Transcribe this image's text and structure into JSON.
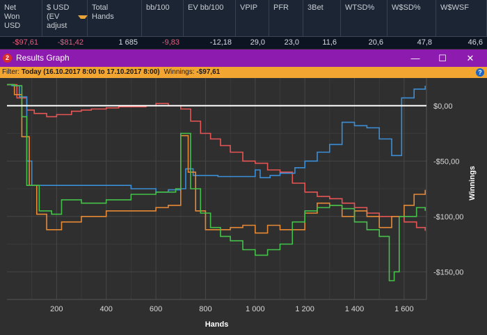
{
  "stats": {
    "columns": [
      {
        "label": "Net Won USD",
        "value": "-$97,61",
        "negative": true
      },
      {
        "label": "$ USD (EV adjust",
        "value": "-$81,42",
        "negative": true,
        "sorted": true
      },
      {
        "label": "Total Hands",
        "value": "1 685",
        "negative": false
      },
      {
        "label": "bb/100",
        "value": "-9,83",
        "negative": true
      },
      {
        "label": "EV bb/100",
        "value": "-12,18",
        "negative": false
      },
      {
        "label": "VPIP",
        "value": "29,0",
        "negative": false
      },
      {
        "label": "PFR",
        "value": "23,0",
        "negative": false
      },
      {
        "label": "3Bet",
        "value": "11,6",
        "negative": false
      },
      {
        "label": "WTSD%",
        "value": "20,6",
        "negative": false
      },
      {
        "label": "W$SD%",
        "value": "47,8",
        "negative": false
      },
      {
        "label": "W$WSF",
        "value": "46,6",
        "negative": false
      }
    ]
  },
  "window": {
    "icon_text": "2",
    "title": "Results Graph",
    "minimize_glyph": "—",
    "maximize_glyph": "☐",
    "close_glyph": "✕"
  },
  "filter": {
    "prefix": "Filter: ",
    "range": "Today (16.10.2017 8:00 to 17.10.2017 8:00)",
    "winnings_label": "Winnings: ",
    "winnings_value": "-$97,61",
    "help_glyph": "?"
  },
  "chart_data": {
    "type": "line",
    "xlabel": "Hands",
    "ylabel": "Winnings",
    "xlim": [
      0,
      1690
    ],
    "ylim": [
      -175,
      25
    ],
    "x_ticks": [
      200,
      400,
      600,
      800,
      1000,
      1200,
      1400,
      1600
    ],
    "x_tick_labels": [
      "200",
      "400",
      "600",
      "800",
      "1 000",
      "1 200",
      "1 400",
      "1 600"
    ],
    "y_ticks": [
      0,
      -50,
      -100,
      -150
    ],
    "y_tick_labels": [
      "$0,00",
      "-$50,00",
      "-$100,00",
      "-$150,00"
    ],
    "grid": true,
    "zero_line_color": "#ffffff",
    "series": [
      {
        "color": "#e85555",
        "points": [
          [
            0,
            19
          ],
          [
            40,
            7
          ],
          [
            80,
            -4
          ],
          [
            110,
            -7
          ],
          [
            160,
            -10
          ],
          [
            200,
            -8
          ],
          [
            260,
            -5
          ],
          [
            300,
            -4
          ],
          [
            340,
            -3
          ],
          [
            400,
            -2
          ],
          [
            450,
            -1
          ],
          [
            500,
            -1
          ],
          [
            560,
            0
          ],
          [
            600,
            2
          ],
          [
            650,
            0
          ],
          [
            700,
            -3
          ],
          [
            740,
            -14
          ],
          [
            780,
            -25
          ],
          [
            820,
            -30
          ],
          [
            860,
            -36
          ],
          [
            900,
            -42
          ],
          [
            950,
            -50
          ],
          [
            1000,
            -52
          ],
          [
            1050,
            -58
          ],
          [
            1100,
            -60
          ],
          [
            1150,
            -70
          ],
          [
            1200,
            -78
          ],
          [
            1250,
            -82
          ],
          [
            1300,
            -84
          ],
          [
            1350,
            -88
          ],
          [
            1400,
            -92
          ],
          [
            1450,
            -97
          ],
          [
            1500,
            -100
          ],
          [
            1550,
            -100
          ],
          [
            1600,
            -105
          ],
          [
            1650,
            -110
          ],
          [
            1685,
            -113
          ]
        ]
      },
      {
        "color": "#3a8fd8",
        "points": [
          [
            0,
            19
          ],
          [
            20,
            18
          ],
          [
            50,
            8
          ],
          [
            80,
            -50
          ],
          [
            100,
            -72
          ],
          [
            200,
            -72
          ],
          [
            300,
            -72
          ],
          [
            400,
            -72
          ],
          [
            500,
            -75
          ],
          [
            600,
            -78
          ],
          [
            650,
            -76
          ],
          [
            700,
            -75
          ],
          [
            720,
            -57
          ],
          [
            750,
            -63
          ],
          [
            850,
            -64
          ],
          [
            950,
            -64
          ],
          [
            1000,
            -58
          ],
          [
            1020,
            -65
          ],
          [
            1060,
            -63
          ],
          [
            1100,
            -61
          ],
          [
            1160,
            -56
          ],
          [
            1200,
            -50
          ],
          [
            1250,
            -42
          ],
          [
            1300,
            -35
          ],
          [
            1350,
            -15
          ],
          [
            1400,
            -18
          ],
          [
            1450,
            -20
          ],
          [
            1500,
            -30
          ],
          [
            1550,
            -45
          ],
          [
            1580,
            -45
          ],
          [
            1590,
            7
          ],
          [
            1640,
            15
          ],
          [
            1685,
            18
          ]
        ]
      },
      {
        "color": "#e88a35",
        "points": [
          [
            0,
            19
          ],
          [
            30,
            10
          ],
          [
            60,
            -28
          ],
          [
            90,
            -72
          ],
          [
            120,
            -98
          ],
          [
            160,
            -112
          ],
          [
            220,
            -105
          ],
          [
            300,
            -100
          ],
          [
            400,
            -95
          ],
          [
            500,
            -95
          ],
          [
            600,
            -92
          ],
          [
            650,
            -90
          ],
          [
            680,
            -90
          ],
          [
            700,
            -27
          ],
          [
            730,
            -60
          ],
          [
            760,
            -95
          ],
          [
            800,
            -112
          ],
          [
            850,
            -112
          ],
          [
            900,
            -110
          ],
          [
            950,
            -108
          ],
          [
            1000,
            -115
          ],
          [
            1050,
            -108
          ],
          [
            1100,
            -112
          ],
          [
            1200,
            -97
          ],
          [
            1250,
            -88
          ],
          [
            1300,
            -90
          ],
          [
            1350,
            -100
          ],
          [
            1400,
            -95
          ],
          [
            1450,
            -100
          ],
          [
            1500,
            -110
          ],
          [
            1550,
            -100
          ],
          [
            1600,
            -90
          ],
          [
            1640,
            -80
          ],
          [
            1685,
            -76
          ]
        ]
      },
      {
        "color": "#44c24a",
        "points": [
          [
            0,
            19
          ],
          [
            30,
            18
          ],
          [
            60,
            -10
          ],
          [
            80,
            -72
          ],
          [
            130,
            -95
          ],
          [
            180,
            -98
          ],
          [
            220,
            -85
          ],
          [
            300,
            -88
          ],
          [
            400,
            -85
          ],
          [
            500,
            -80
          ],
          [
            600,
            -78
          ],
          [
            650,
            -78
          ],
          [
            680,
            -75
          ],
          [
            700,
            -25
          ],
          [
            740,
            -75
          ],
          [
            780,
            -97
          ],
          [
            820,
            -110
          ],
          [
            860,
            -118
          ],
          [
            900,
            -122
          ],
          [
            950,
            -130
          ],
          [
            1000,
            -135
          ],
          [
            1050,
            -130
          ],
          [
            1100,
            -125
          ],
          [
            1150,
            -105
          ],
          [
            1200,
            -95
          ],
          [
            1250,
            -92
          ],
          [
            1300,
            -90
          ],
          [
            1350,
            -93
          ],
          [
            1400,
            -105
          ],
          [
            1450,
            -112
          ],
          [
            1500,
            -118
          ],
          [
            1540,
            -158
          ],
          [
            1560,
            -150
          ],
          [
            1580,
            -100
          ],
          [
            1600,
            -100
          ],
          [
            1650,
            -92
          ],
          [
            1685,
            -95
          ]
        ]
      }
    ]
  }
}
